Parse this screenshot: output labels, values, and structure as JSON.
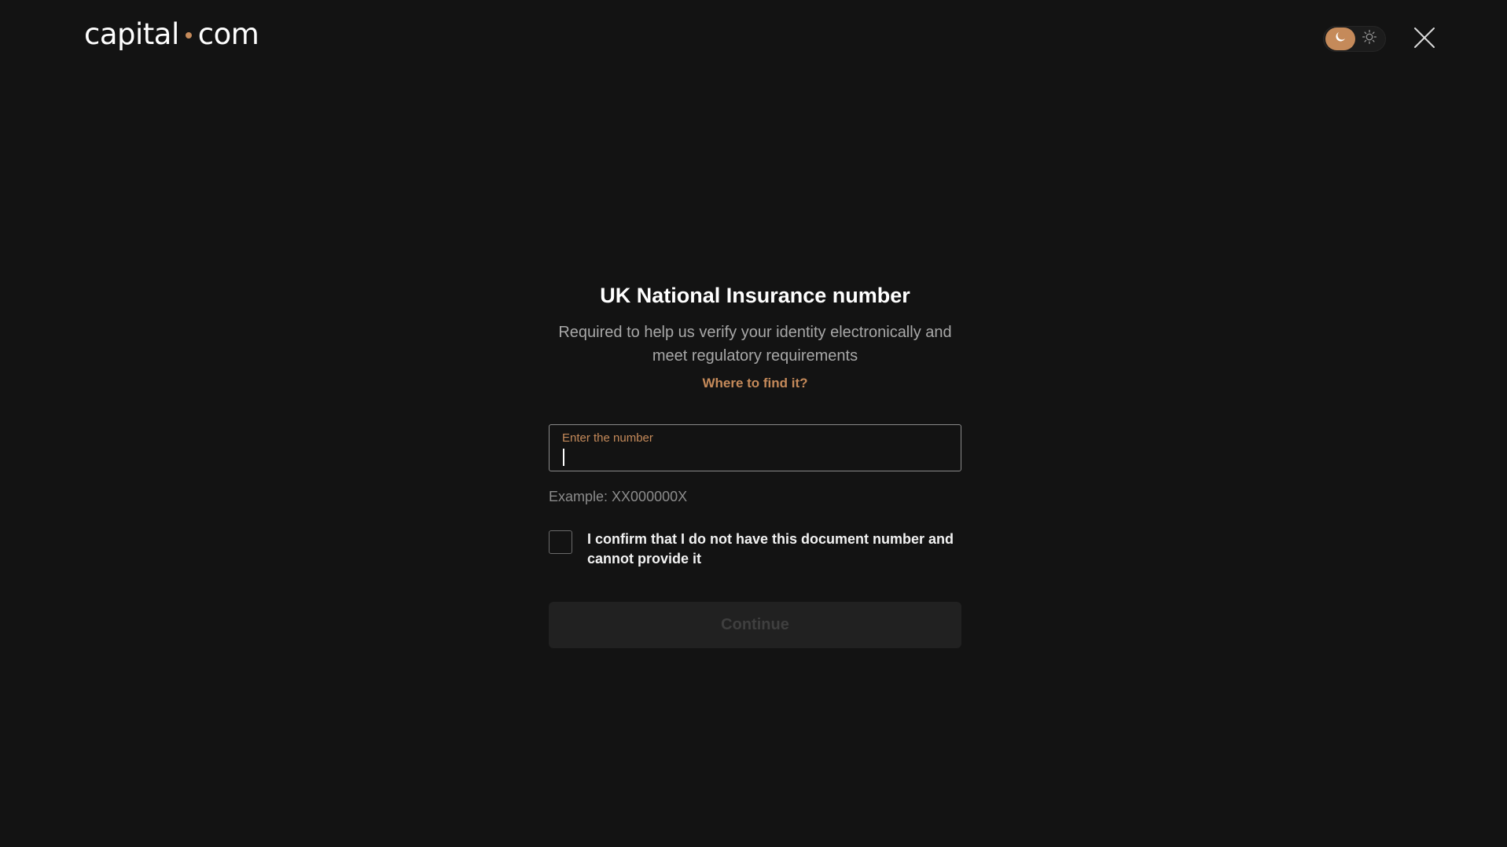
{
  "header": {
    "logo_left": "capital",
    "logo_right": "com",
    "close_label": "Close"
  },
  "colors": {
    "accent": "#c58a5a",
    "background": "#131313",
    "button_disabled_bg": "#212121"
  },
  "icons": {
    "theme_dark": "moon-icon",
    "theme_light": "sun-icon",
    "close": "close-icon"
  },
  "form": {
    "title": "UK National Insurance number",
    "subtitle": "Required to help us verify your identity electronically and meet regulatory requirements",
    "find_link": "Where to find it?",
    "input_label": "Enter the number",
    "input_value": "",
    "example": "Example: XX000000X",
    "confirm_text": "I confirm that I do not have this document number and cannot provide it",
    "continue_label": "Continue"
  }
}
